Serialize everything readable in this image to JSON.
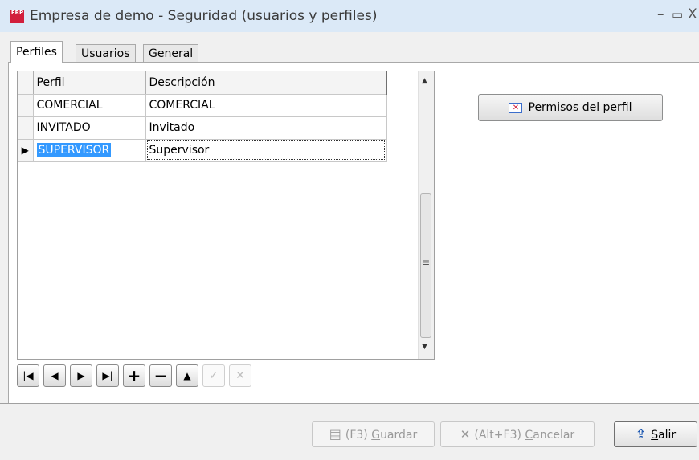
{
  "window": {
    "title": "Empresa de demo - Seguridad (usuarios y perfiles)",
    "icon_text": "ERP",
    "minimize": "–",
    "maximize": "▭",
    "close": "X"
  },
  "tabs": [
    {
      "label": "Perfiles",
      "active": true
    },
    {
      "label": "Usuarios",
      "active": false
    },
    {
      "label": "General",
      "active": false
    }
  ],
  "grid": {
    "columns": [
      "Perfil",
      "Descripción"
    ],
    "rows": [
      {
        "perfil": "COMERCIAL",
        "descripcion": "COMERCIAL",
        "selected": false
      },
      {
        "perfil": "INVITADO",
        "descripcion": "Invitado",
        "selected": false
      },
      {
        "perfil": "SUPERVISOR",
        "descripcion": "Supervisor",
        "selected": true
      }
    ],
    "row_indicator": "▶",
    "scroll_up": "▲",
    "scroll_down": "▼",
    "scroll_grip": "≡"
  },
  "navigator": [
    {
      "name": "first",
      "glyph": "|◀",
      "enabled": true
    },
    {
      "name": "prior",
      "glyph": "◀",
      "enabled": true
    },
    {
      "name": "next",
      "glyph": "▶",
      "enabled": true
    },
    {
      "name": "last",
      "glyph": "▶|",
      "enabled": true
    },
    {
      "name": "insert",
      "glyph": "+",
      "enabled": true
    },
    {
      "name": "delete",
      "glyph": "−",
      "enabled": true
    },
    {
      "name": "edit",
      "glyph": "▲",
      "enabled": true
    },
    {
      "name": "post",
      "glyph": "✓",
      "enabled": false
    },
    {
      "name": "cancel",
      "glyph": "✕",
      "enabled": false
    }
  ],
  "permisos_button": {
    "mnemonic": "P",
    "rest": "ermisos del perfil"
  },
  "footer": {
    "guardar": {
      "prefix": "(F3) ",
      "mnemonic": "G",
      "rest": "uardar",
      "icon": "▤",
      "enabled": false
    },
    "cancelar": {
      "prefix": "(Alt+F3) ",
      "mnemonic": "C",
      "rest": "ancelar",
      "icon": "✕",
      "enabled": false
    },
    "salir": {
      "mnemonic": "S",
      "rest": "alir",
      "icon": "⇪",
      "enabled": true
    }
  },
  "colors": {
    "selection": "#3399ff",
    "titlebar": "#dbe9f7",
    "accent": "#d21f3c"
  }
}
